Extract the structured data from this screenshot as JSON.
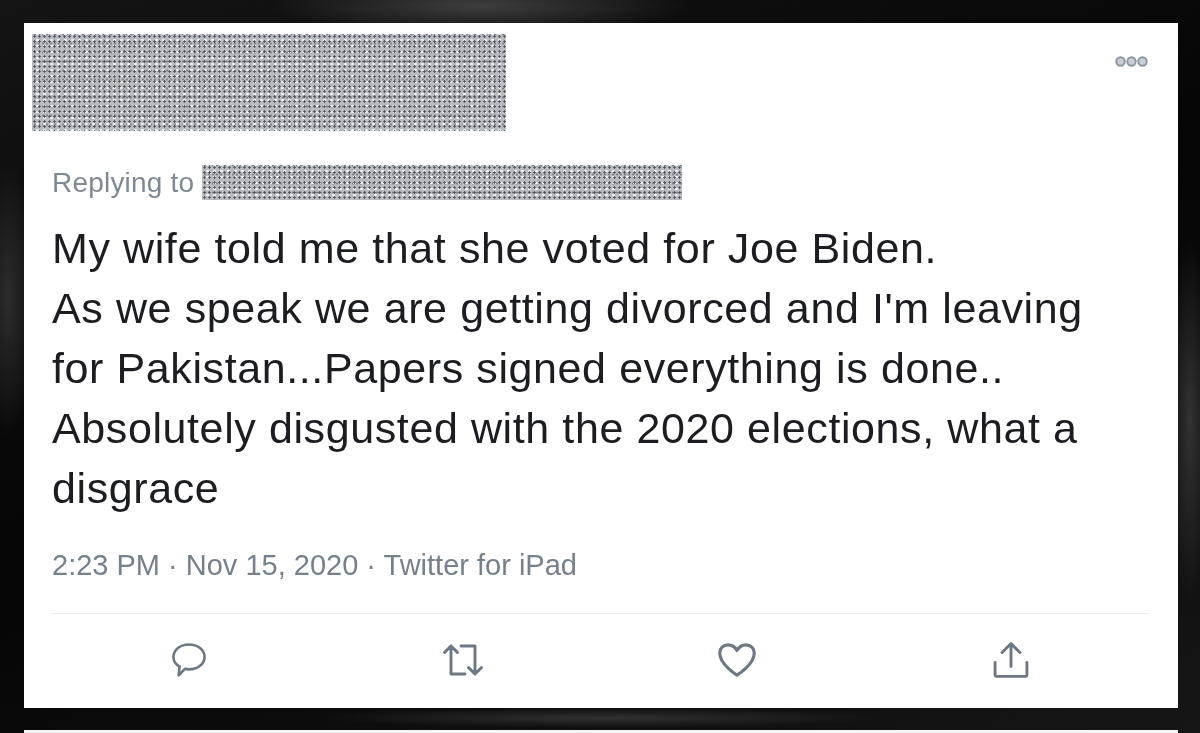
{
  "tweet": {
    "reply_label": "Replying to",
    "text": "My wife told me that she voted for Joe Biden.\nAs we speak we are getting divorced and I'm leaving for Pakistan...Papers signed everything is done..\nAbsolutely disgusted with the 2020 elections, what a disgrace",
    "timestamp": "2:23 PM · Nov 15, 2020 · Twitter for iPad"
  },
  "actions": [
    {
      "kind": "reply"
    },
    {
      "kind": "retweet"
    },
    {
      "kind": "like"
    },
    {
      "kind": "share"
    }
  ]
}
